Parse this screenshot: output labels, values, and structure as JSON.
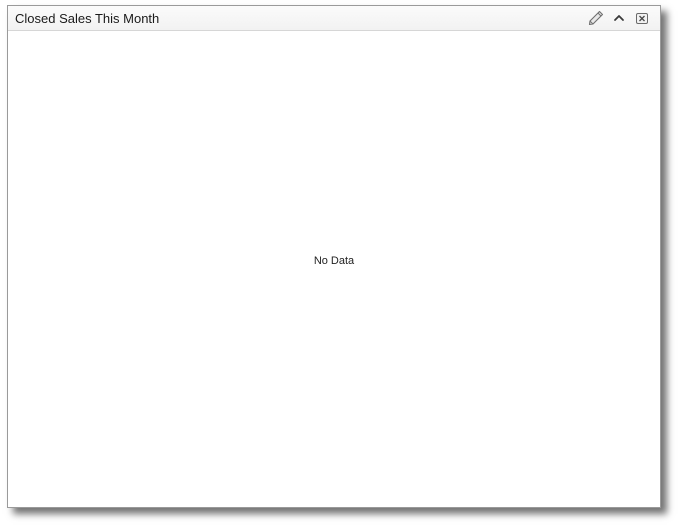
{
  "widget": {
    "title": "Closed Sales This Month",
    "empty_message": "No Data",
    "tools": [
      {
        "name": "edit",
        "icon": "pencil-icon"
      },
      {
        "name": "collapse",
        "icon": "chevron-up-icon"
      },
      {
        "name": "close",
        "icon": "close-box-icon"
      }
    ]
  },
  "colors": {
    "border": "#9a9a9a",
    "titlebar": "#f4f4f4",
    "text": "#1a1a1a"
  }
}
